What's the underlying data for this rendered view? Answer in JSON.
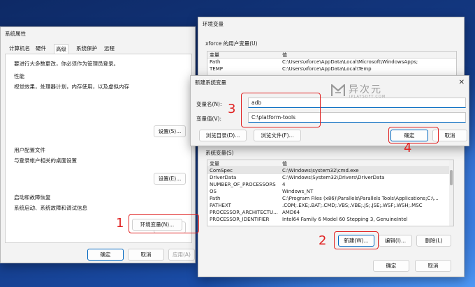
{
  "sys_props": {
    "title": "系统属性",
    "tabs": [
      "计算机名",
      "硬件",
      "高级",
      "系统保护",
      "远程"
    ],
    "admin_note": "要进行大多数更改，你必须作为管理员登录。",
    "perf": {
      "title": "性能",
      "desc": "视觉效果，处理器计划，内存使用，以及虚拟内存",
      "btn": "设置(S)..."
    },
    "profile": {
      "title": "用户配置文件",
      "desc": "与登录帐户相关的桌面设置",
      "btn": "设置(E)..."
    },
    "startup": {
      "title": "启动和故障恢复",
      "desc": "系统启动、系统故障和调试信息",
      "btn": "设置(T)..."
    },
    "env_btn": "环境变量(N)...",
    "ok": "确定",
    "cancel": "取消",
    "apply": "应用(A)"
  },
  "env_vars": {
    "title": "环境变量",
    "user_section": "xforce 的用户变量(U)",
    "col_var": "变量",
    "col_val": "值",
    "user_rows": [
      {
        "name": "Path",
        "value": "C:\\Users\\xforce\\AppData\\Local\\Microsoft\\WindowsApps;"
      },
      {
        "name": "TEMP",
        "value": "C:\\Users\\xforce\\AppData\\Local\\Temp"
      }
    ],
    "sys_section": "系统变量(S)",
    "sys_rows": [
      {
        "name": "ComSpec",
        "value": "C:\\Windows\\system32\\cmd.exe"
      },
      {
        "name": "DriverData",
        "value": "C:\\Windows\\System32\\Drivers\\DriverData"
      },
      {
        "name": "NUMBER_OF_PROCESSORS",
        "value": "4"
      },
      {
        "name": "OS",
        "value": "Windows_NT"
      },
      {
        "name": "Path",
        "value": "C:\\Program Files (x86)\\Parallels\\Parallels Tools\\Applications;C:\\..."
      },
      {
        "name": "PATHEXT",
        "value": ".COM;.EXE;.BAT;.CMD;.VBS;.VBE;.JS;.JSE;.WSF;.WSH;.MSC"
      },
      {
        "name": "PROCESSOR_ARCHITECTU...",
        "value": "AMD64"
      },
      {
        "name": "PROCESSOR_IDENTIFIER",
        "value": "Intel64 Family 6 Model 60 Stepping 3, GenuineIntel"
      }
    ],
    "new_btn": "新建(W)...",
    "edit_btn": "编辑(I)...",
    "delete_btn": "删除(L)",
    "ok": "确定",
    "cancel": "取消"
  },
  "new_var": {
    "title": "新建系统变量",
    "name_label": "变量名(N):",
    "name_value": "adb",
    "value_label": "变量值(V):",
    "value_value": "C:\\platform-tools",
    "browse_dir": "浏览目录(D)...",
    "browse_file": "浏览文件(F)...",
    "ok": "确定",
    "cancel": "取消"
  },
  "steps": [
    "1",
    "2",
    "3",
    "4"
  ],
  "watermark": {
    "text": "异次元",
    "sub": "IPLAYSOFT.COM"
  },
  "colors": {
    "accent": "#0067c0",
    "annotation": "#e02020"
  }
}
